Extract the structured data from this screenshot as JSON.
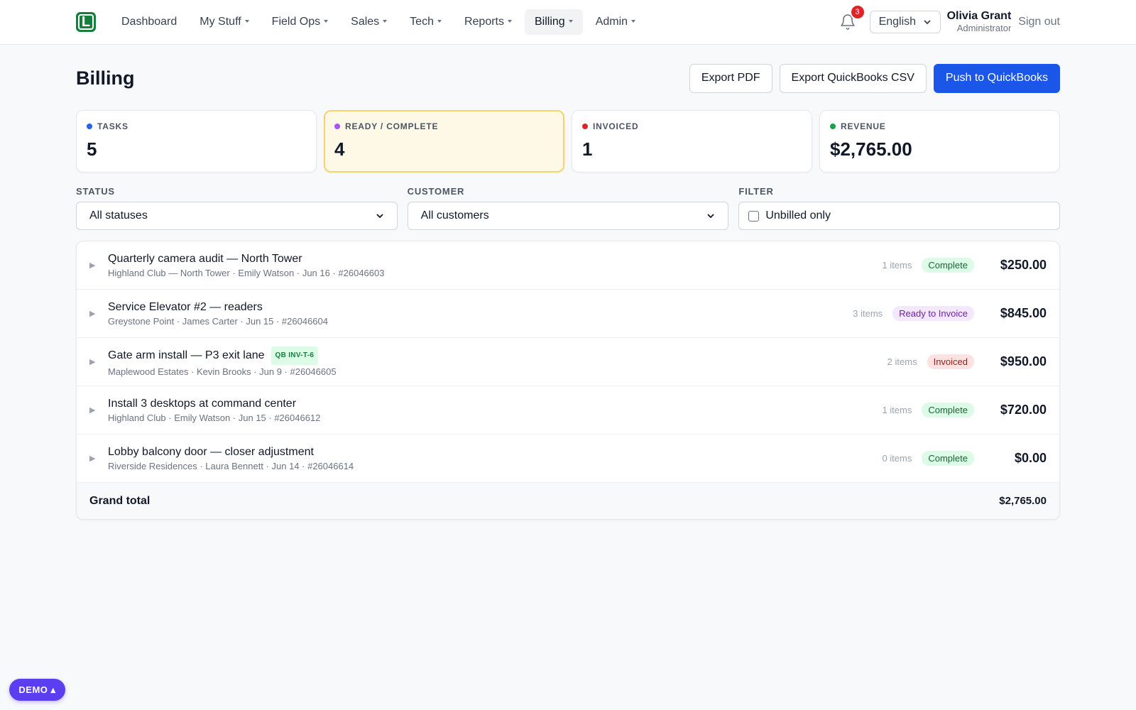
{
  "nav": {
    "logo_letter": "L",
    "items": [
      {
        "label": "Dashboard",
        "dropdown": false
      },
      {
        "label": "My Stuff",
        "dropdown": true
      },
      {
        "label": "Field Ops",
        "dropdown": true
      },
      {
        "label": "Sales",
        "dropdown": true
      },
      {
        "label": "Tech",
        "dropdown": true
      },
      {
        "label": "Reports",
        "dropdown": true
      },
      {
        "label": "Billing",
        "dropdown": true,
        "active": true
      },
      {
        "label": "Admin",
        "dropdown": true
      }
    ],
    "notification_count": "3",
    "language": "English",
    "user_name": "Olivia Grant",
    "user_role": "Administrator",
    "sign_out": "Sign out"
  },
  "header": {
    "title": "Billing",
    "export_pdf": "Export PDF",
    "export_csv": "Export QuickBooks CSV",
    "push_qb": "Push to QuickBooks"
  },
  "stats": [
    {
      "label": "TASKS",
      "value": "5",
      "dot_color": "#2563eb"
    },
    {
      "label": "READY / COMPLETE",
      "value": "4",
      "dot_color": "#a855f7"
    },
    {
      "label": "INVOICED",
      "value": "1",
      "dot_color": "#dc2626"
    },
    {
      "label": "REVENUE",
      "value": "$2,765.00",
      "dot_color": "#16a34a"
    }
  ],
  "filters": {
    "status_label": "STATUS",
    "status_value": "All statuses",
    "customer_label": "CUSTOMER",
    "customer_value": "All customers",
    "filter_label": "FILTER",
    "unbilled_label": "Unbilled only"
  },
  "tasks": [
    {
      "title": "Quarterly camera audit — North Tower",
      "subtitle": "Highland Club — North Tower · Emily Watson · Jun 16 · #26046603",
      "items": "1 items",
      "status": "Complete",
      "amount": "$250.00",
      "qb": ""
    },
    {
      "title": "Service Elevator #2 — readers",
      "subtitle": "Greystone Point · James Carter · Jun 15 · #26046604",
      "items": "3 items",
      "status": "Ready to Invoice",
      "amount": "$845.00",
      "qb": ""
    },
    {
      "title": "Gate arm install — P3 exit lane",
      "subtitle": "Maplewood Estates · Kevin Brooks · Jun 9 · #26046605",
      "items": "2 items",
      "status": "Invoiced",
      "amount": "$950.00",
      "qb": "QB INV-T-6"
    },
    {
      "title": "Install 3 desktops at command center",
      "subtitle": "Highland Club · Emily Watson · Jun 15 · #26046612",
      "items": "1 items",
      "status": "Complete",
      "amount": "$720.00",
      "qb": ""
    },
    {
      "title": "Lobby balcony door — closer adjustment",
      "subtitle": "Riverside Residences · Laura Bennett · Jun 14 · #26046614",
      "items": "0 items",
      "status": "Complete",
      "amount": "$0.00",
      "qb": ""
    }
  ],
  "total": {
    "label": "Grand total",
    "amount": "$2,765.00"
  },
  "demo": {
    "label": "DEMO ▴"
  }
}
